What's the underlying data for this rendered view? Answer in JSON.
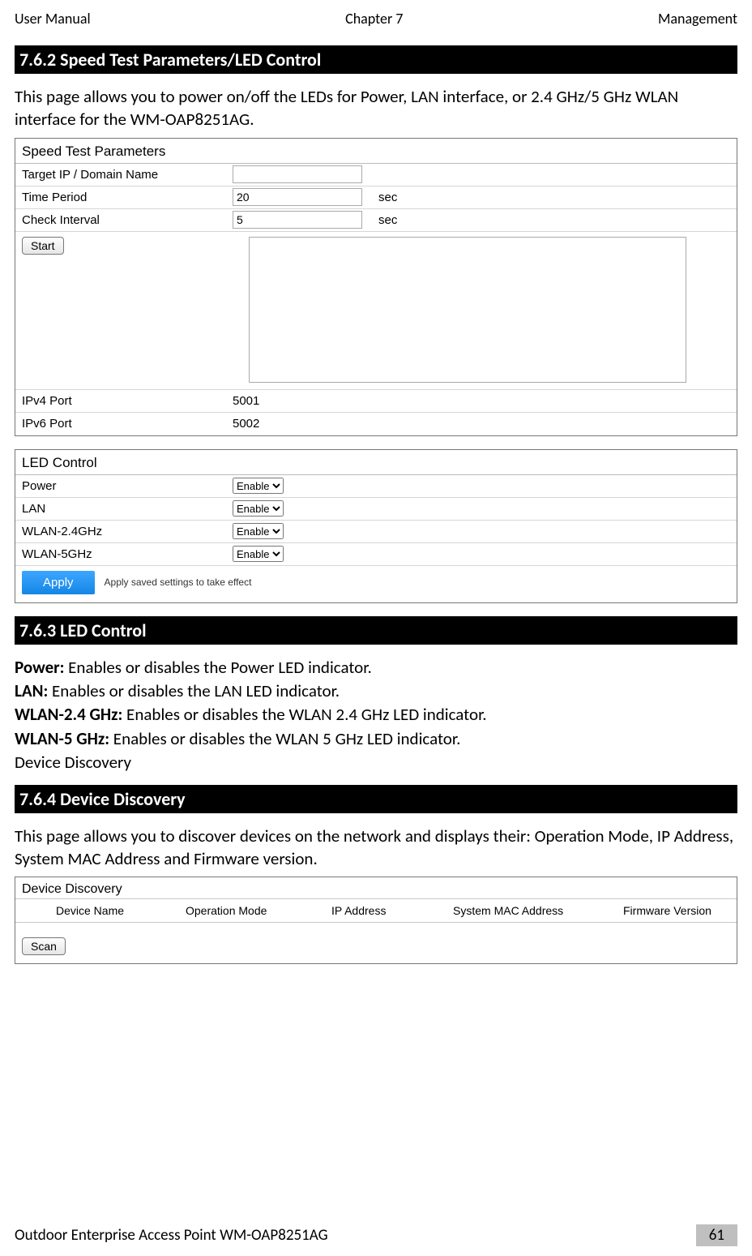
{
  "header": {
    "left": "User Manual",
    "center": "Chapter 7",
    "right": "Management"
  },
  "sections": {
    "s1": {
      "heading": "7.6.2 Speed Test Parameters/LED Control",
      "intro": "This page allows you to power on/off the LEDs for Power, LAN interface, or 2.4 GHz/5 GHz WLAN interface for the WM-OAP8251AG."
    },
    "s2": {
      "heading": "7.6.3 LED Control"
    },
    "s3": {
      "heading": "7.6.4 Device Discovery",
      "intro": "This page allows you to discover devices on the network and displays their: Operation Mode, IP Address, System MAC Address and Firmware version."
    }
  },
  "speed_test": {
    "panel_title": "Speed Test Parameters",
    "target_label": "Target IP / Domain Name",
    "target_value": "",
    "time_label": "Time Period",
    "time_value": "20",
    "time_unit": "sec",
    "check_label": "Check Interval",
    "check_value": "5",
    "check_unit": "sec",
    "start": "Start",
    "ipv4_label": "IPv4 Port",
    "ipv4_value": "5001",
    "ipv6_label": "IPv6 Port",
    "ipv6_value": "5002"
  },
  "led": {
    "panel_title": "LED Control",
    "power_label": "Power",
    "power_value": "Enable",
    "lan_label": "LAN",
    "lan_value": "Enable",
    "wlan24_label": "WLAN-2.4GHz",
    "wlan24_value": "Enable",
    "wlan5_label": "WLAN-5GHz",
    "wlan5_value": "Enable",
    "apply": "Apply",
    "apply_note": "Apply saved settings to take effect"
  },
  "led_desc": {
    "power_k": "Power:",
    "power_v": " Enables or disables the Power LED indicator.",
    "lan_k": "LAN:",
    "lan_v": " Enables or disables the LAN LED indicator.",
    "w24_k": "WLAN-2.4 GHz:",
    "w24_v": " Enables or disables the WLAN 2.4 GHz LED indicator.",
    "w5_k": "WLAN-5 GHz:",
    "w5_v": " Enables or disables the WLAN 5 GHz LED indicator.",
    "dd_line": "Device Discovery"
  },
  "discovery": {
    "panel_title": "Device Discovery",
    "cols": {
      "c1": "Device Name",
      "c2": "Operation Mode",
      "c3": "IP Address",
      "c4": "System MAC Address",
      "c5": "Firmware Version"
    },
    "scan": "Scan"
  },
  "footer": {
    "left": "Outdoor Enterprise Access Point WM-OAP8251AG",
    "page": "61"
  }
}
